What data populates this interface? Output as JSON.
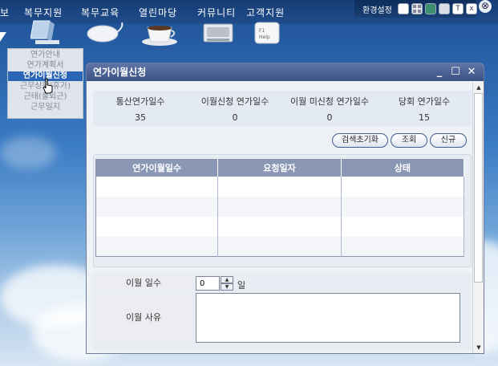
{
  "nav": {
    "items": [
      "보",
      "복무지원",
      "복무교육",
      "열린마당",
      "커뮤니티",
      "고객지원"
    ]
  },
  "util": {
    "label": "환경설정",
    "t_label": "T",
    "x_label": "x"
  },
  "dropdown": {
    "items": [
      "연가안내",
      "연가계획서",
      "연가이월신청",
      "근무상황(휴가)",
      "근태(출퇴근)",
      "근무일지"
    ]
  },
  "dialog": {
    "title": "연가이월신청",
    "summary": [
      {
        "label": "통산연가일수",
        "value": "35"
      },
      {
        "label": "이월신청 연가일수",
        "value": "0"
      },
      {
        "label": "이월 미신청 연가일수",
        "value": "0"
      },
      {
        "label": "당회 연가일수",
        "value": "15"
      }
    ],
    "buttons": {
      "reset": "검색초기화",
      "search": "조회",
      "new": "신규"
    },
    "grid": {
      "headers": [
        "연가이월일수",
        "요청일자",
        "상태"
      ]
    },
    "form": {
      "days_label": "이월 일수",
      "days_value": "0",
      "days_unit": "일",
      "reason_label": "이월 사유",
      "reason_value": ""
    }
  },
  "colors": {
    "title_bar": "#3b5286",
    "grid_header": "#8a98b6",
    "active_menu": "#2b66b6"
  }
}
